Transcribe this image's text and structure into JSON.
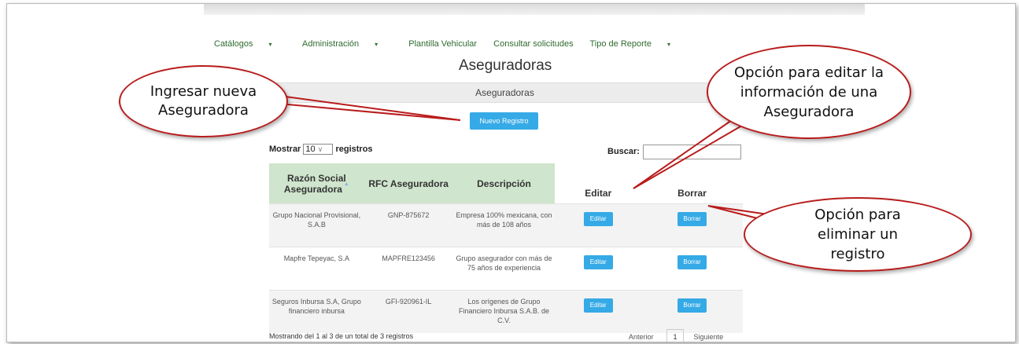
{
  "nav": [
    {
      "label": "Catálogos",
      "caret": "▾"
    },
    {
      "label": "Administración",
      "caret": "▾"
    },
    {
      "label": "Plantilla Vehicular",
      "caret": ""
    },
    {
      "label": "Consultar solicitudes",
      "caret": ""
    },
    {
      "label": "Tipo de Reporte",
      "caret": "▾"
    }
  ],
  "page_title": "Aseguradoras",
  "panel_title": "Aseguradoras",
  "new_button": "Nuevo Registro",
  "length": {
    "prefix": "Mostrar",
    "value": "10",
    "suffix": "registros"
  },
  "search": {
    "label": "Buscar:",
    "value": ""
  },
  "table": {
    "headers": [
      "Razón Social Aseguradora",
      "RFC Aseguradora",
      "Descripción",
      "Editar",
      "Borrar"
    ],
    "rows": [
      {
        "razon": "Grupo Nacional Provisional, S.A.B",
        "rfc": "GNP-875672",
        "descripcion": "Empresa 100% mexicana, con más de 108 años",
        "editar": "Editar",
        "borrar": "Borrar"
      },
      {
        "razon": "Mapfre Tepeyac, S.A",
        "rfc": "MAPFRE123456",
        "descripcion": "Grupo asegurador con más de 75 años de experiencia",
        "editar": "Editar",
        "borrar": "Borrar"
      },
      {
        "razon": "Seguros Inbursa S.A, Grupo financiero inbursa",
        "rfc": "GFI-920961-IL",
        "descripcion": "Los orígenes de Grupo Financiero Inbursa S.A.B. de C.V.",
        "editar": "Editar",
        "borrar": "Borrar"
      }
    ]
  },
  "footer": {
    "info": "Mostrando del 1 al 3 de un total de 3 registros",
    "prev": "Anterior",
    "page": "1",
    "next": "Siguiente"
  },
  "callouts": {
    "nuevo": "Ingresar nueva Aseguradora",
    "editar": "Opción para editar la información de una Aseguradora",
    "eliminar": "Opción para eliminar un registro"
  },
  "colors": {
    "accent_button": "#35aae6",
    "nav_text": "#2f6b2f",
    "header_green": "#cfe5cd",
    "callout_border": "#b91c1c"
  }
}
